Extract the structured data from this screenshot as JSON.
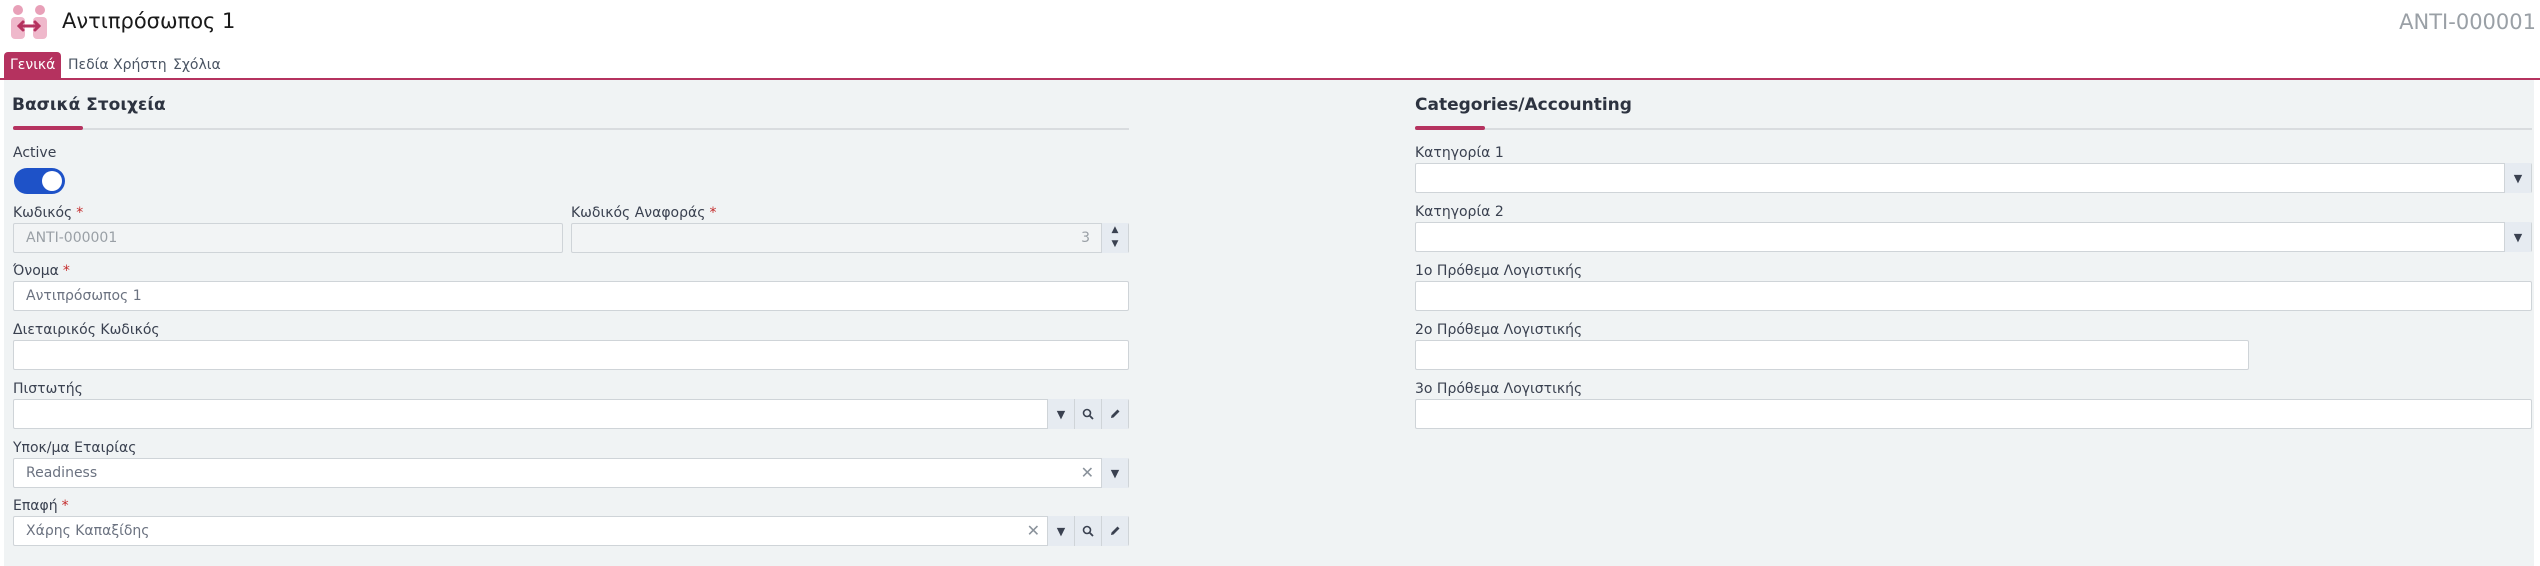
{
  "header": {
    "title": "Αντιπρόσωπος 1",
    "record_code": "ANTI-000001",
    "logo_icon": "representatives-people-icon"
  },
  "tabs": [
    {
      "label": "Γενικά",
      "active": true
    },
    {
      "label": "Πεδία Χρήστη",
      "active": false
    },
    {
      "label": "Σχόλια",
      "active": false
    }
  ],
  "basic": {
    "title": "Βασικά Στοιχεία",
    "active_label": "Active",
    "active_value": true,
    "code_label": "Κωδικός",
    "code_value": "ANTI-000001",
    "ref_code_label": "Κωδικός Αναφοράς",
    "ref_code_value": "3",
    "name_label": "Όνομα",
    "name_value": "Αντιπρόσωπος 1",
    "intl_code_label": "Διεταιρικός Κωδικός",
    "intl_code_value": "",
    "creditor_label": "Πιστωτής",
    "creditor_value": "",
    "company_branch_label": "Υποκ/μα Εταιρίας",
    "company_branch_value": "Readiness",
    "contact_label": "Επαφή",
    "contact_value": "Χάρης Καπαξίδης",
    "required_mark": "*"
  },
  "accounting": {
    "title": "Categories/Accounting",
    "cat1_label": "Κατηγορία 1",
    "cat1_value": "",
    "cat2_label": "Κατηγορία 2",
    "cat2_value": "",
    "prefix1_label": "1ο Πρόθεμα Λογιστικής",
    "prefix2_label": "2ο Πρόθεμα Λογιστικής",
    "prefix3_label": "3ο Πρόθεμα Λογιστικής"
  },
  "colors": {
    "accent": "#b5325f",
    "toggle_on": "#1e52c8",
    "panel_bg": "#f0f3f4"
  }
}
